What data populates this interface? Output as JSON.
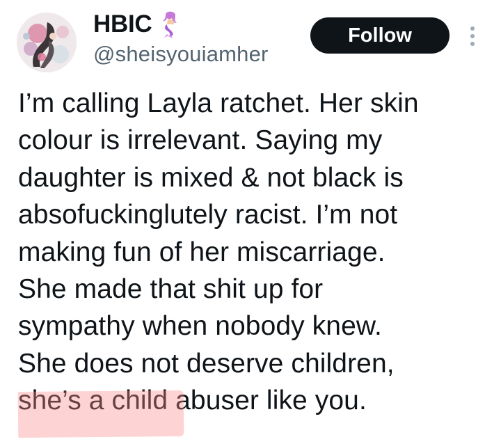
{
  "user": {
    "display_name": "HBIC",
    "name_emoji": "mermaid-emoji",
    "handle": "@sheisyouiamher"
  },
  "actions": {
    "follow_label": "Follow",
    "more_icon": "more-vertical-icon"
  },
  "tweet": {
    "lines": [
      "I’m calling Layla ratchet. Her skin",
      "colour is irrelevant. Saying my",
      "daughter is mixed & not black is",
      "absofuckinglutely racist. I’m not",
      "making fun of her miscarriage.",
      "She made that shit up for",
      "sympathy when nobody knew.",
      "She does not deserve children,",
      "she’s a child abuser like you."
    ]
  },
  "colors": {
    "text": "#0f1419",
    "secondary": "#536471",
    "follow_bg": "#0f1419",
    "highlight": "#fa8c8c"
  }
}
